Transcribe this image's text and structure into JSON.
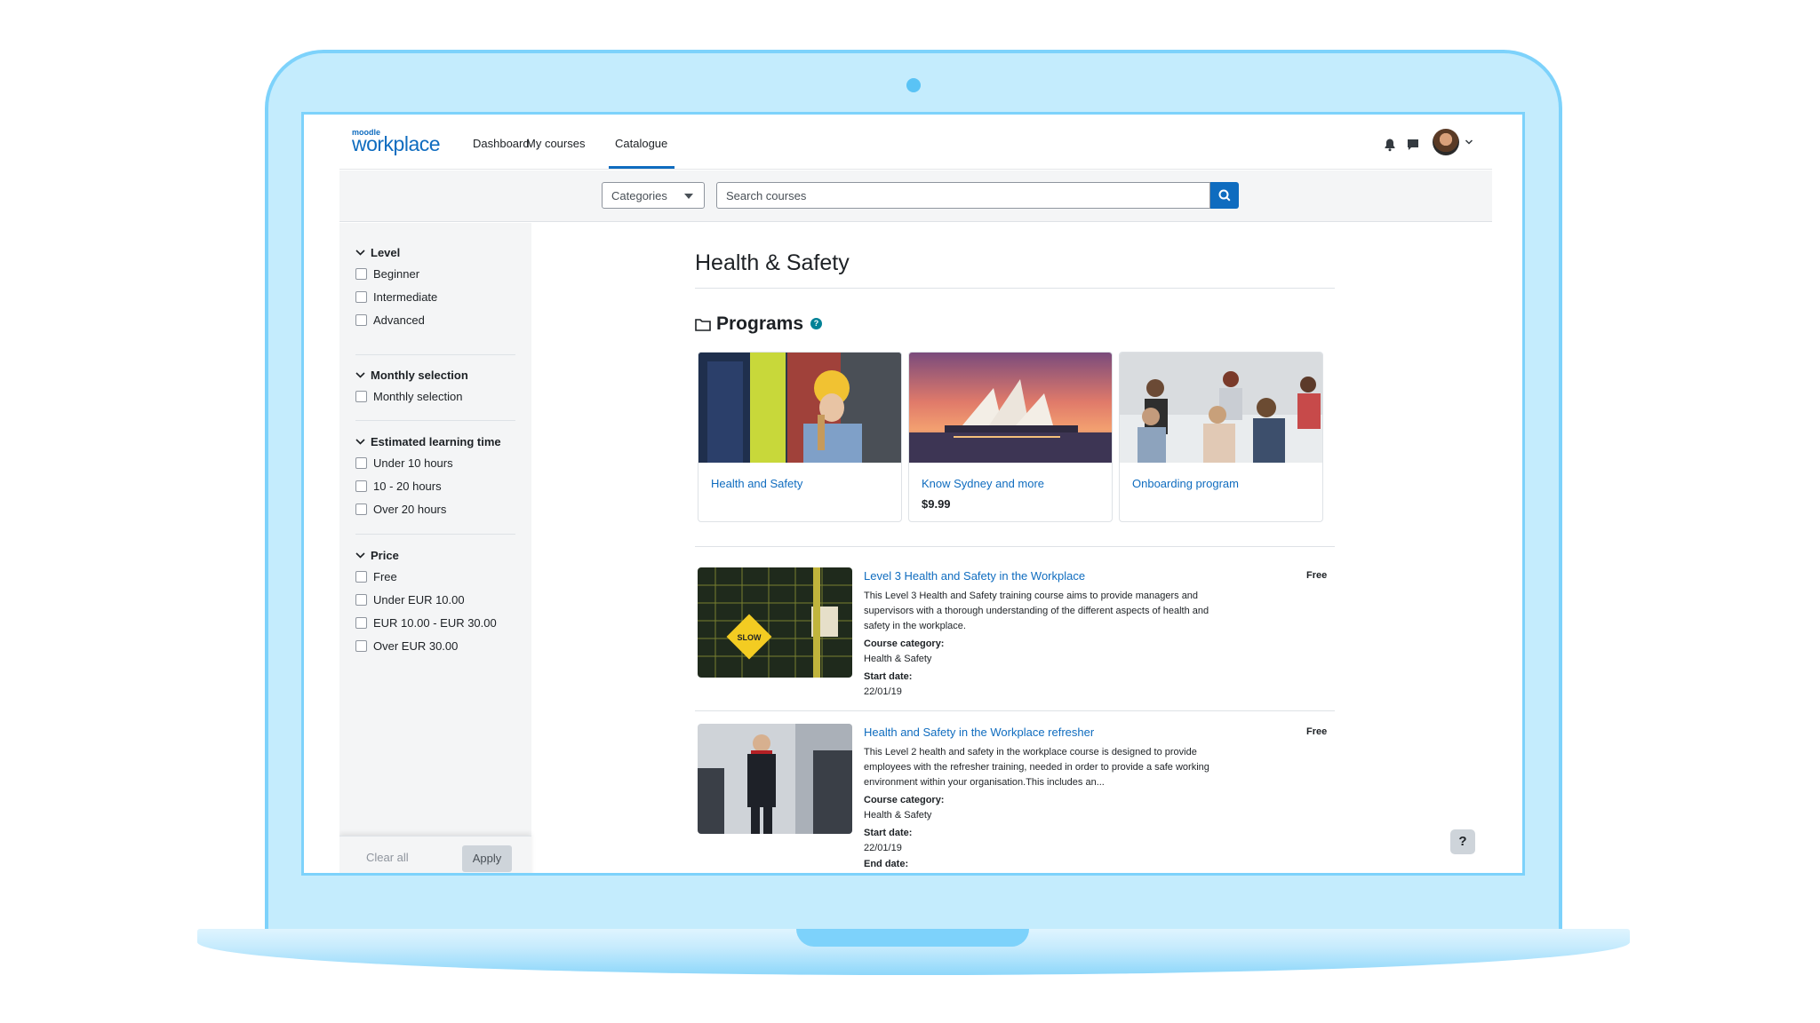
{
  "brand": {
    "logo_small": "moodle",
    "logo_big": "workplace",
    "accent": "#0f6cbf"
  },
  "nav": {
    "links": [
      {
        "label": "Dashboard"
      },
      {
        "label": "My courses"
      },
      {
        "label": "Catalogue",
        "active": true
      }
    ],
    "icons": [
      "bell-icon",
      "messages-icon",
      "avatar",
      "chevron-down-icon"
    ]
  },
  "search": {
    "category_select": "Categories",
    "placeholder": "Search courses",
    "button_icon": "search-icon"
  },
  "filters": {
    "groups": [
      {
        "heading": "Level",
        "options": [
          "Beginner",
          "Intermediate",
          "Advanced"
        ]
      },
      {
        "heading": "Monthly selection",
        "options": [
          "Monthly selection"
        ]
      },
      {
        "heading": "Estimated learning time",
        "options": [
          "Under 10 hours",
          "10 - 20 hours",
          "Over 20 hours"
        ]
      },
      {
        "heading": "Price",
        "options": [
          "Free",
          "Under EUR 10.00",
          "EUR 10.00 - EUR 30.00",
          "Over EUR 30.00"
        ]
      }
    ],
    "clear_label": "Clear all",
    "apply_label": "Apply"
  },
  "main": {
    "title": "Health & Safety",
    "programs_heading": "Programs",
    "help_glyph": "?",
    "programs": [
      {
        "name": "Health and Safety",
        "price": ""
      },
      {
        "name": "Know Sydney and more",
        "price": "$9.99"
      },
      {
        "name": "Onboarding program",
        "price": ""
      }
    ],
    "courses": [
      {
        "title": "Level 3 Health and Safety in the Workplace",
        "price": "Free",
        "description": "This Level 3 Health and Safety training course aims to provide managers and supervisors with a thorough understanding of the different aspects of health and safety in the workplace.",
        "category_label": "Course category:",
        "category": "Health & Safety",
        "start_label": "Start date:",
        "start": "22/01/19",
        "sign_text": "SLOW"
      },
      {
        "title": "Health and Safety in the Workplace refresher",
        "price": "Free",
        "description": "This Level 2 health and safety in the workplace course is designed to provide employees with the refresher training, needed in order to provide a safe working environment within your organisation.This includes an...",
        "category_label": "Course category:",
        "category": "Health & Safety",
        "start_label": "Start date:",
        "start": "22/01/19",
        "end_label": "End date:"
      }
    ]
  },
  "help_button": "?"
}
